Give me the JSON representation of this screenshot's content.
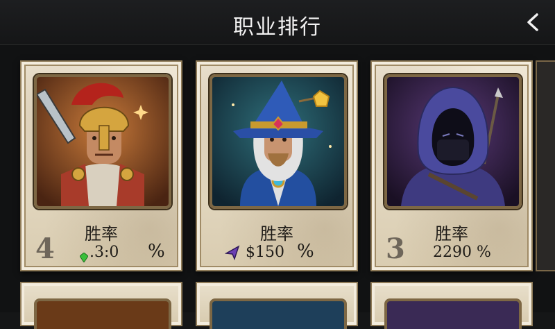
{
  "header": {
    "title": "职业排行",
    "back_icon": "chevron-left-icon"
  },
  "cards": [
    {
      "label": "胜率",
      "rank": "4",
      "value": ".3:0",
      "percent": "%",
      "gem_icon": "green-gem-icon",
      "hero": "spartan-warrior"
    },
    {
      "label": "胜率",
      "rank": "",
      "value": "$150",
      "percent": "%",
      "gem_icon": "purple-crystal-icon",
      "hero": "wizard"
    },
    {
      "label": "胜率",
      "rank": "3",
      "value": "2290 %",
      "percent": "",
      "gem_icon": "",
      "hero": "hooded-rogue"
    }
  ],
  "colors": {
    "card_bg": "#e6dcc6",
    "frame": "#7d6744",
    "page_bg": "#151617",
    "title": "#f2f2f2"
  }
}
